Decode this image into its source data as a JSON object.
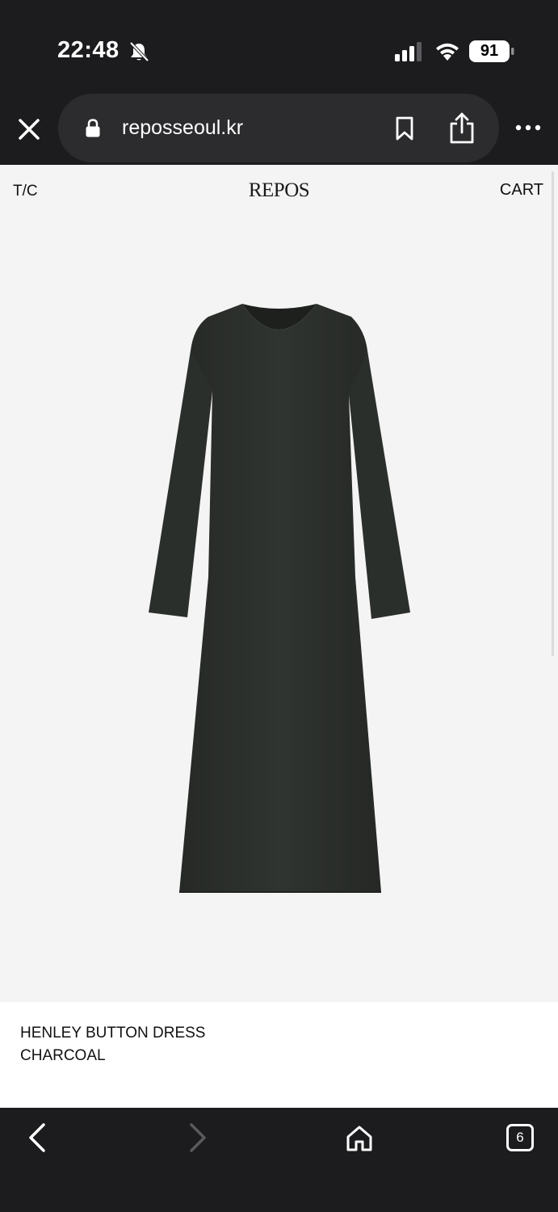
{
  "status": {
    "time": "22:48",
    "battery": "91",
    "icons": [
      "bell-slash-icon",
      "cellular-signal-icon",
      "wifi-icon",
      "battery-icon"
    ]
  },
  "browser": {
    "url": "reposseoul.kr",
    "icons": [
      "close-icon",
      "lock-icon",
      "bookmark-icon",
      "share-icon",
      "more-icon"
    ]
  },
  "site": {
    "nav_left": "T/C",
    "brand": "REPOS",
    "nav_right": "CART"
  },
  "product": {
    "name": "HENLEY BUTTON DRESS",
    "color": "CHARCOAL",
    "image_color": "#2f332f"
  },
  "toolbar": {
    "tab_count": "6",
    "icons": [
      "back-icon",
      "forward-icon",
      "home-icon",
      "tabs-icon"
    ]
  }
}
